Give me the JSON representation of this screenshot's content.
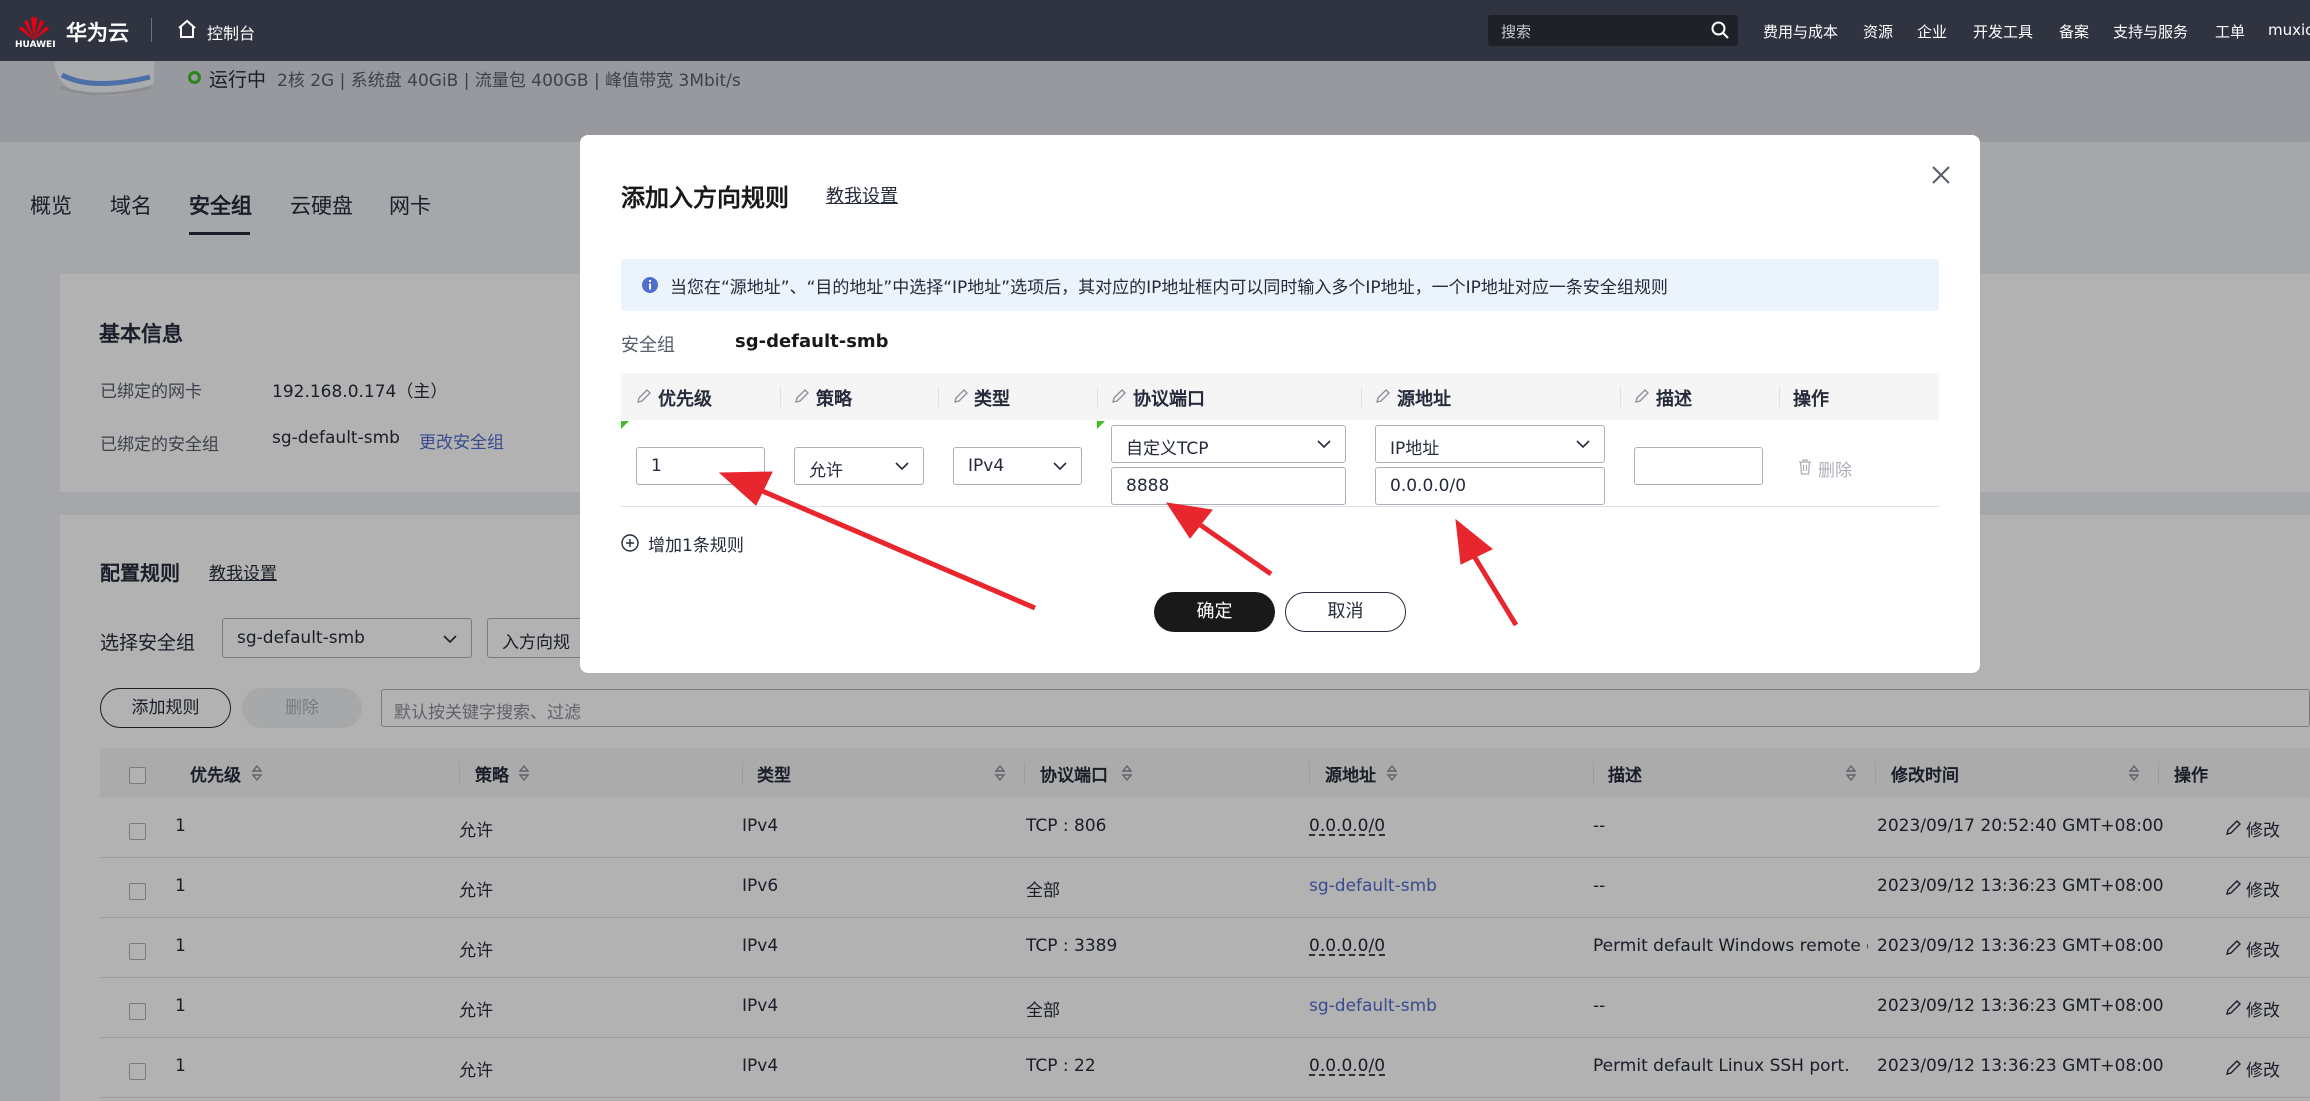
{
  "topbar": {
    "logo_text": "HUAWEI",
    "brand": "华为云",
    "console": "控制台",
    "search_placeholder": "搜索",
    "nav": [
      "费用与成本",
      "资源",
      "企业",
      "开发工具",
      "备案",
      "支持与服务",
      "工单",
      "muxio"
    ]
  },
  "server": {
    "status": "运行中",
    "specs": "2核 2G | 系统盘 40GiB | 流量包 400GB | 峰值带宽 3Mbit/s"
  },
  "tabs": [
    "概览",
    "域名",
    "安全组",
    "云硬盘",
    "网卡"
  ],
  "basic_info": {
    "title": "基本信息",
    "nic_label": "已绑定的网卡",
    "nic_value": "192.168.0.174（主）",
    "sg_label": "已绑定的安全组",
    "sg_value": "sg-default-smb",
    "change_link": "更改安全组"
  },
  "config": {
    "title": "配置规则",
    "teach": "教我设置",
    "select_label": "选择安全组",
    "select_value": "sg-default-smb",
    "direction_value": "入方向规",
    "add_rule_btn": "添加规则",
    "delete_btn": "删除",
    "filter_placeholder": "默认按关键字搜索、过滤"
  },
  "table": {
    "headers": [
      "优先级",
      "策略",
      "类型",
      "协议端口",
      "源地址",
      "描述",
      "修改时间",
      "操作"
    ],
    "rows": [
      {
        "priority": "1",
        "policy": "允许",
        "type": "IPv4",
        "port": "TCP : 806",
        "source": "0.0.0.0/0",
        "desc": "--",
        "time": "2023/09/17 20:52:40 GMT+08:00",
        "op": "修改"
      },
      {
        "priority": "1",
        "policy": "允许",
        "type": "IPv6",
        "port": "全部",
        "source": "sg-default-smb",
        "desc": "--",
        "time": "2023/09/12 13:36:23 GMT+08:00",
        "op": "修改"
      },
      {
        "priority": "1",
        "policy": "允许",
        "type": "IPv4",
        "port": "TCP : 3389",
        "source": "0.0.0.0/0",
        "desc": "Permit default Windows remote d...",
        "time": "2023/09/12 13:36:23 GMT+08:00",
        "op": "修改"
      },
      {
        "priority": "1",
        "policy": "允许",
        "type": "IPv4",
        "port": "全部",
        "source": "sg-default-smb",
        "desc": "--",
        "time": "2023/09/12 13:36:23 GMT+08:00",
        "op": "修改"
      },
      {
        "priority": "1",
        "policy": "允许",
        "type": "IPv4",
        "port": "TCP : 22",
        "source": "0.0.0.0/0",
        "desc": "Permit default Linux SSH port.",
        "time": "2023/09/12 13:36:23 GMT+08:00",
        "op": "修改"
      }
    ]
  },
  "dialog": {
    "title": "添加入方向规则",
    "teach": "教我设置",
    "info": "当您在“源地址”、“目的地址”中选择“IP地址”选项后，其对应的IP地址框内可以同时输入多个IP地址，一个IP地址对应一条安全组规则",
    "sg_label": "安全组",
    "sg_value": "sg-default-smb",
    "headers": [
      "优先级",
      "策略",
      "类型",
      "协议端口",
      "源地址",
      "描述",
      "操作"
    ],
    "row": {
      "priority": "1",
      "policy": "允许",
      "type": "IPv4",
      "protocol": "自定义TCP",
      "port": "8888",
      "source_type": "IP地址",
      "source": "0.0.0.0/0",
      "desc": "",
      "delete": "删除"
    },
    "add_rule": "增加1条规则",
    "ok": "确定",
    "cancel": "取消"
  },
  "colors": {
    "topbar": "#2f3440",
    "link": "#526ecc",
    "arrow": "#e8262d",
    "status_ok": "#3fbf24",
    "primary_button": "#191919"
  }
}
